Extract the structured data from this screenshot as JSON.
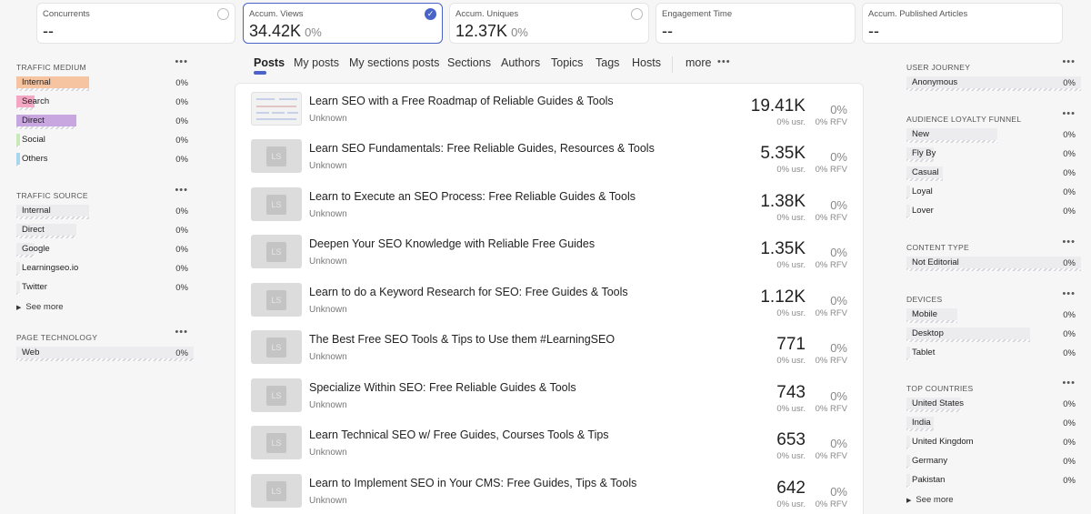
{
  "metrics": [
    {
      "label": "Concurrents",
      "value": "--",
      "pct": ""
    },
    {
      "label": "Accum. Views",
      "value": "34.42K",
      "pct": "0%"
    },
    {
      "label": "Accum. Uniques",
      "value": "12.37K",
      "pct": "0%"
    },
    {
      "label": "Engagement Time",
      "value": "--",
      "pct": ""
    },
    {
      "label": "Accum. Published Articles",
      "value": "--",
      "pct": ""
    }
  ],
  "left": {
    "traffic_medium": {
      "title": "TRAFFIC MEDIUM",
      "items": [
        {
          "label": "Internal",
          "value": "0%",
          "color": "#f6c4a1"
        },
        {
          "label": "Search",
          "value": "0%",
          "color": "#f4a7c3"
        },
        {
          "label": "Direct",
          "value": "0%",
          "color": "#c8a6e0"
        },
        {
          "label": "Social",
          "value": "0%",
          "color": "#c8e9b8"
        },
        {
          "label": "Others",
          "value": "0%",
          "color": "#a9d6ee"
        }
      ]
    },
    "traffic_source": {
      "title": "TRAFFIC SOURCE",
      "items": [
        {
          "label": "Internal",
          "value": "0%"
        },
        {
          "label": "Direct",
          "value": "0%"
        },
        {
          "label": "Google",
          "value": "0%"
        },
        {
          "label": "Learningseo.io",
          "value": "0%"
        },
        {
          "label": "Twitter",
          "value": "0%"
        }
      ],
      "see_more": "See more"
    },
    "page_technology": {
      "title": "PAGE TECHNOLOGY",
      "items": [
        {
          "label": "Web",
          "value": "0%"
        }
      ]
    }
  },
  "tabs": [
    "Posts",
    "My posts",
    "My sections posts",
    "Sections",
    "Authors",
    "Topics",
    "Tags",
    "Hosts"
  ],
  "tabs_more": "more",
  "posts": [
    {
      "title": "Learn SEO with a Free Roadmap of Reliable Guides & Tools",
      "sub": "Unknown",
      "views": "19.41K",
      "usr": "0% usr.",
      "pct": "0%",
      "rfv": "0% RFV"
    },
    {
      "title": "Learn SEO Fundamentals: Free Reliable Guides, Resources & Tools",
      "sub": "Unknown",
      "views": "5.35K",
      "usr": "0% usr.",
      "pct": "0%",
      "rfv": "0% RFV"
    },
    {
      "title": "Learn to Execute an SEO Process: Free Reliable Guides & Tools",
      "sub": "Unknown",
      "views": "1.38K",
      "usr": "0% usr.",
      "pct": "0%",
      "rfv": "0% RFV"
    },
    {
      "title": "Deepen Your SEO Knowledge with Reliable Free Guides",
      "sub": "Unknown",
      "views": "1.35K",
      "usr": "0% usr.",
      "pct": "0%",
      "rfv": "0% RFV"
    },
    {
      "title": "Learn to do a Keyword Research for SEO: Free Guides & Tools",
      "sub": "Unknown",
      "views": "1.12K",
      "usr": "0% usr.",
      "pct": "0%",
      "rfv": "0% RFV"
    },
    {
      "title": "The Best Free SEO Tools & Tips to Use them #LearningSEO",
      "sub": "Unknown",
      "views": "771",
      "usr": "0% usr.",
      "pct": "0%",
      "rfv": "0% RFV"
    },
    {
      "title": "Specialize Within SEO: Free Reliable Guides & Tools",
      "sub": "Unknown",
      "views": "743",
      "usr": "0% usr.",
      "pct": "0%",
      "rfv": "0% RFV"
    },
    {
      "title": "Learn Technical SEO w/ Free Guides, Courses Tools & Tips",
      "sub": "Unknown",
      "views": "653",
      "usr": "0% usr.",
      "pct": "0%",
      "rfv": "0% RFV"
    },
    {
      "title": "Learn to Implement SEO in Your CMS: Free Guides, Tips & Tools",
      "sub": "Unknown",
      "views": "642",
      "usr": "0% usr.",
      "pct": "0%",
      "rfv": "0% RFV"
    }
  ],
  "thumb_placeholder": "LS",
  "right": {
    "user_journey": {
      "title": "USER JOURNEY",
      "items": [
        {
          "label": "Anonymous",
          "value": "0%"
        }
      ]
    },
    "loyalty": {
      "title": "AUDIENCE LOYALTY FUNNEL",
      "items": [
        {
          "label": "New",
          "value": "0%"
        },
        {
          "label": "Fly By",
          "value": "0%"
        },
        {
          "label": "Casual",
          "value": "0%"
        },
        {
          "label": "Loyal",
          "value": "0%"
        },
        {
          "label": "Lover",
          "value": "0%"
        }
      ]
    },
    "content_type": {
      "title": "CONTENT TYPE",
      "items": [
        {
          "label": "Not Editorial",
          "value": "0%"
        }
      ]
    },
    "devices": {
      "title": "DEVICES",
      "items": [
        {
          "label": "Mobile",
          "value": "0%"
        },
        {
          "label": "Desktop",
          "value": "0%"
        },
        {
          "label": "Tablet",
          "value": "0%"
        }
      ]
    },
    "countries": {
      "title": "TOP COUNTRIES",
      "items": [
        {
          "label": "United States",
          "value": "0%"
        },
        {
          "label": "India",
          "value": "0%"
        },
        {
          "label": "United Kingdom",
          "value": "0%"
        },
        {
          "label": "Germany",
          "value": "0%"
        },
        {
          "label": "Pakistan",
          "value": "0%"
        }
      ],
      "see_more": "See more"
    }
  }
}
